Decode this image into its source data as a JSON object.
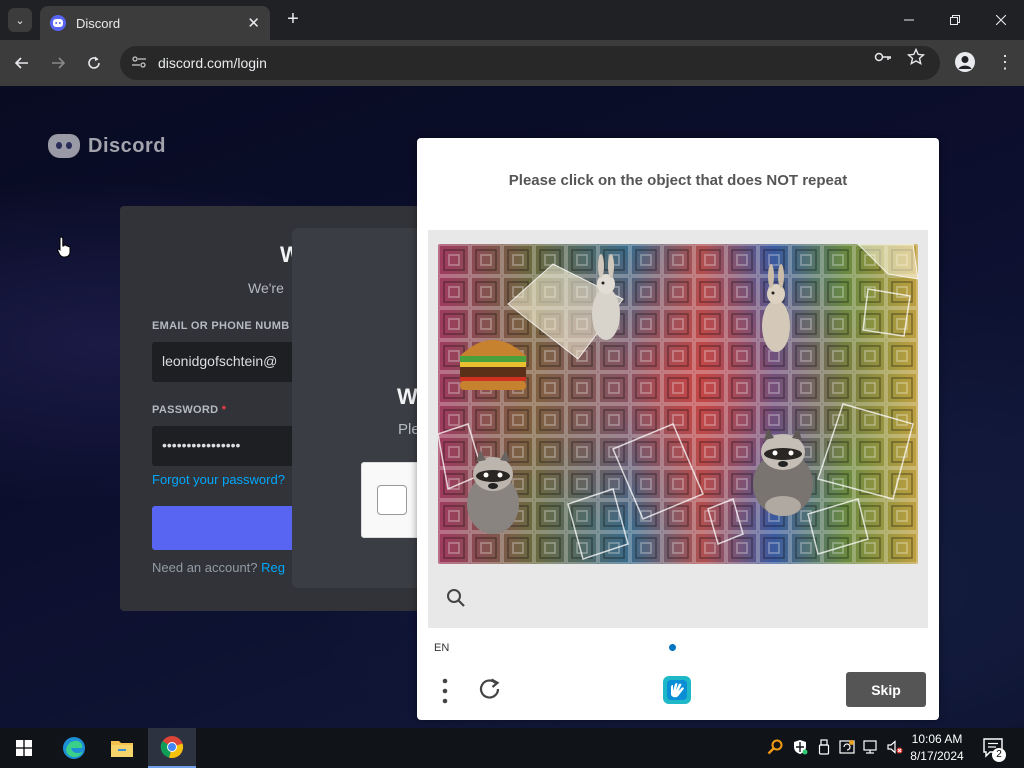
{
  "browser": {
    "tab_title": "Discord",
    "new_tab_symbol": "+",
    "url": "discord.com/login",
    "window_controls": [
      "minimize",
      "restore",
      "close"
    ]
  },
  "discord": {
    "brand": "Discord",
    "login": {
      "title": "W",
      "subtitle": "We're",
      "email_label": "EMAIL OR PHONE NUMB",
      "email_value": "leonidgofschtein@",
      "password_label": "PASSWORD",
      "required_mark": "*",
      "password_value": "••••••••••••••••",
      "forgot_link": "Forgot your password?",
      "footer_text": "Need an account?",
      "footer_link": "Reg"
    },
    "overlay": {
      "title": "W",
      "subtitle": "Ple"
    }
  },
  "captcha": {
    "prompt": "Please click on the object that does NOT repeat",
    "language": "EN",
    "skip_label": "Skip",
    "icons": [
      "zoom-icon",
      "menu-icon",
      "refresh-icon",
      "hcaptcha-logo-icon"
    ]
  },
  "taskbar": {
    "time": "10:06 AM",
    "date": "8/17/2024",
    "notification_count": "2",
    "apps": [
      "windows-start-icon",
      "edge-icon",
      "file-explorer-icon",
      "chrome-icon"
    ],
    "accent": "#6fa0e8"
  }
}
